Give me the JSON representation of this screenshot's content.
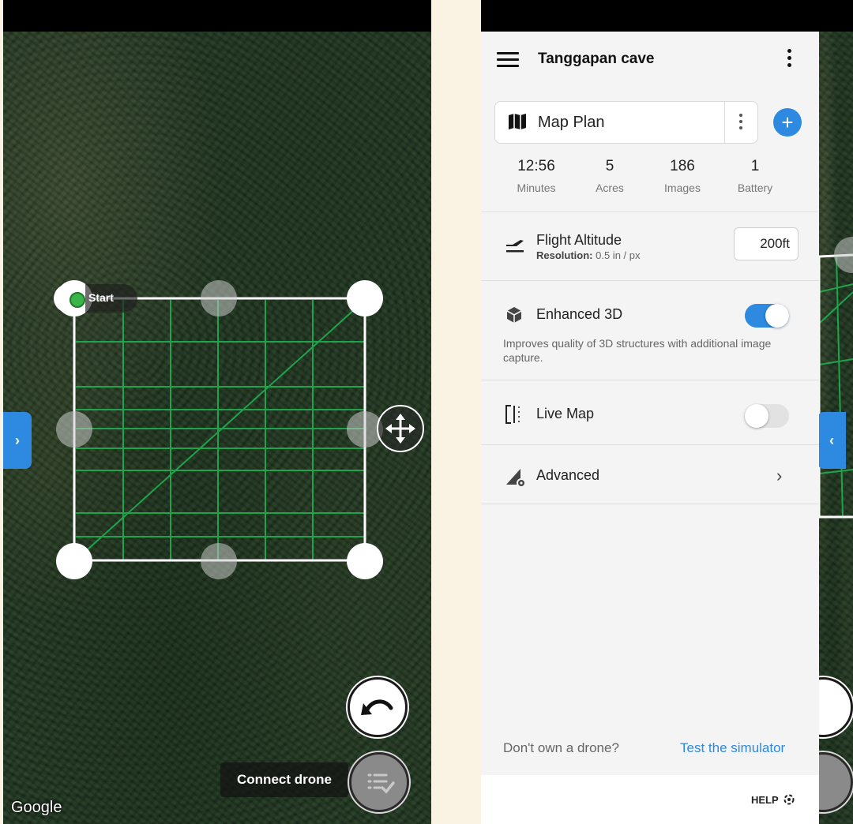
{
  "left_screen": {
    "start_label": "Start",
    "connect_label": "Connect drone",
    "map_attribution": "Google"
  },
  "right_screen": {
    "header": {
      "title": "Tanggapan cave"
    },
    "plan": {
      "name": "Map Plan"
    },
    "stats": [
      {
        "value": "12:56",
        "label": "Minutes"
      },
      {
        "value": "5",
        "label": "Acres"
      },
      {
        "value": "186",
        "label": "Images"
      },
      {
        "value": "1",
        "label": "Battery"
      }
    ],
    "flight_altitude": {
      "label": "Flight Altitude",
      "resolution_label": "Resolution:",
      "resolution_value": "0.5 in / px",
      "value": "200ft"
    },
    "enhanced_3d": {
      "label": "Enhanced 3D",
      "description": "Improves quality of 3D structures with additional image capture.",
      "enabled": true
    },
    "live_map": {
      "label": "Live Map",
      "enabled": false
    },
    "advanced": {
      "label": "Advanced"
    },
    "footer": {
      "question": "Don't own a drone?",
      "simulator_link": "Test the simulator",
      "help": "HELP"
    }
  },
  "colors": {
    "accent": "#2d8ae0",
    "grid_line": "#1fb050",
    "start_dot": "#3bb54a"
  }
}
